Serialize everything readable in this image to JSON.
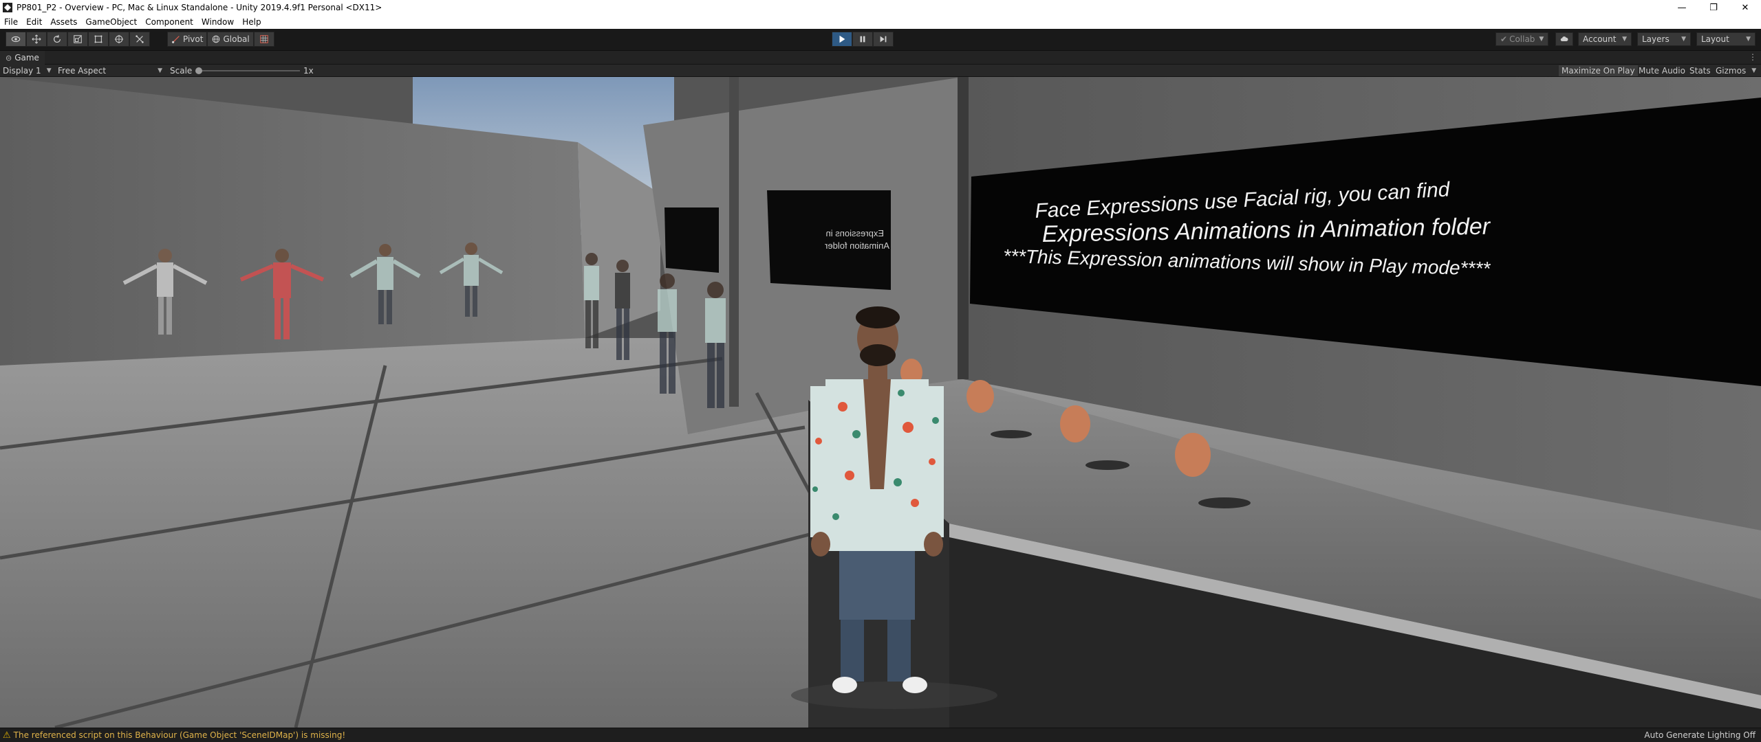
{
  "window": {
    "title": "PP801_P2 - Overview - PC, Mac & Linux Standalone - Unity 2019.4.9f1 Personal <DX11>",
    "controls": {
      "minimize": "—",
      "restore": "❐",
      "close": "✕"
    }
  },
  "menu": [
    "File",
    "Edit",
    "Assets",
    "GameObject",
    "Component",
    "Window",
    "Help"
  ],
  "toolbar": {
    "tools": [
      {
        "id": "view-tool",
        "icon": "eye-icon",
        "active": true
      },
      {
        "id": "move-tool",
        "icon": "move-arrows-icon",
        "active": false
      },
      {
        "id": "rotate-tool",
        "icon": "rotate-icon",
        "active": false
      },
      {
        "id": "scale-tool",
        "icon": "scale-icon",
        "active": false
      },
      {
        "id": "rect-tool",
        "icon": "rect-tool-icon",
        "active": false
      },
      {
        "id": "transform-tool",
        "icon": "transform-icon",
        "active": false
      },
      {
        "id": "custom-tool",
        "icon": "custom-tool-icon",
        "active": false
      }
    ],
    "pivot_label": "Pivot",
    "global_label": "Global",
    "collab_label": "Collab",
    "account_label": "Account",
    "layers_label": "Layers",
    "layout_label": "Layout"
  },
  "game_tab": {
    "label": "Game",
    "display_label": "Display 1",
    "aspect_label": "Free Aspect",
    "scale_label": "Scale",
    "scale_value": "1x",
    "scale_fraction": 0.02,
    "maximize_label": "Maximize On Play",
    "mute_label": "Mute Audio",
    "stats_label": "Stats",
    "gizmos_label": "Gizmos"
  },
  "scene": {
    "sign_lines": [
      "Face Expressions use Facial rig, you can find",
      "Expressions Animations in Animation folder",
      "***This Expression animations will show in Play mode****"
    ],
    "small_sign_lines": [
      "Expressions in",
      "Animation folder"
    ]
  },
  "status": {
    "message": "The referenced script on this Behaviour (Game Object 'SceneIDMap') is missing!",
    "right": "Auto Generate Lighting Off"
  },
  "colors": {
    "play_active": "#2e5a85",
    "warning": "#e0b34a"
  }
}
